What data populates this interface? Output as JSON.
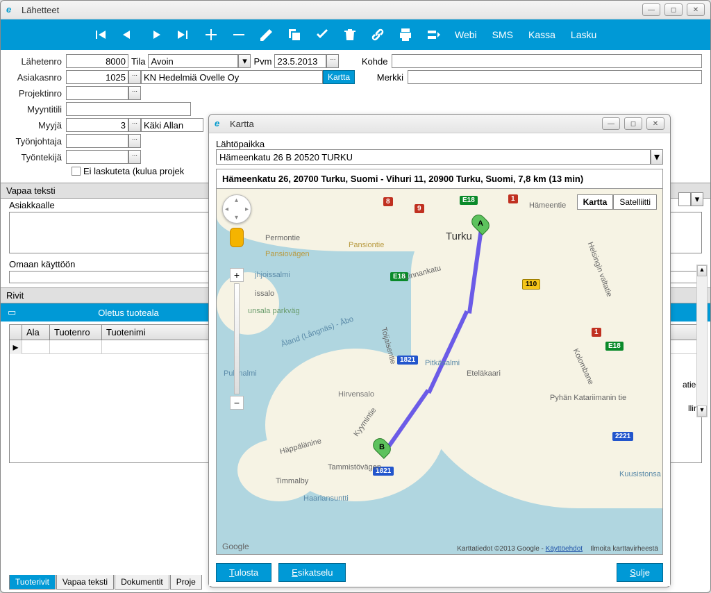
{
  "main": {
    "title": "Lähetteet",
    "toolbar_text": [
      "Webi",
      "SMS",
      "Kassa",
      "Lasku"
    ],
    "fields": {
      "lahetenro_label": "Lähetenro",
      "lahetenro": "8000",
      "tila_label": "Tila",
      "tila": "Avoin",
      "pvm_label": "Pvm",
      "pvm": "23.5.2013",
      "kohde_label": "Kohde",
      "merkki_label": "Merkki",
      "asiakasnro_label": "Asiakasnro",
      "asiakasnro": "1025",
      "asiakasnimi": "KN Hedelmiä Ovelle Oy",
      "kartta_btn": "Kartta",
      "projektinro_label": "Projektinro",
      "myyntitili_label": "Myyntitili",
      "myyja_label": "Myyjä",
      "myyja": "3",
      "myyja_nimi": "Käki Allan",
      "tyonjohtaja_label": "Työnjohtaja",
      "tyontekija_label": "Työntekijä",
      "ei_laskuteta": "Ei laskuteta (kulua projek"
    },
    "sections": {
      "vapaa_teksti": "Vapaa teksti",
      "asiakkaalle": "Asiakkaalle",
      "omaan_kayttoon": "Omaan käyttöön",
      "rivit": "Rivit",
      "oletus_tuoteala": "Oletus tuoteala",
      "atiedot": "atiedot",
      "llinen": "llinen"
    },
    "grid_headers": [
      "Ala",
      "Tuotenro",
      "Tuotenimi"
    ],
    "tabs": [
      "Tuoterivit",
      "Vapaa teksti",
      "Dokumentit",
      "Proje"
    ]
  },
  "map_dialog": {
    "title": "Kartta",
    "lahtopaikka_label": "Lähtöpaikka",
    "lahtopaikka": "Hämeenkatu 26 B 20520 TURKU",
    "route_header": "Hämeenkatu 26, 20700 Turku, Suomi - Vihuri 11, 20900 Turku, Suomi, 7,8 km (13 min)",
    "map_type_kartta": "Kartta",
    "map_type_satelliitti": "Satelliitti",
    "marker_a": "A",
    "marker_b": "B",
    "city_label": "Turku",
    "labels": {
      "permontie": "Permontie",
      "pansiovagen": "Pansiovägen",
      "pansiontie": "Pansiontie",
      "jhjoissalmi": "jhjoissalmi",
      "issalo": "issalo",
      "unsala_parkvag": "unsala parkväg",
      "aland": "Åland (Långnäs) - Åbo",
      "linnankatu": "Linnankatu",
      "pukinalmi": "Pukinalmi",
      "hirvensalo": "Hirvensalo",
      "tammistovagen": "Tammistövägen",
      "haarlansuntti": "Haarlansuntti",
      "pitkasalmi": "Pitkäsalmi",
      "etelakaari": "Eteläkaari",
      "hameentie": "Hämeentie",
      "pyhankat": "Pyhän Katariimanin tie",
      "helsingin": "Helsingin valtatie",
      "kuusistonsa": "Kuusistonsa",
      "toijaisentie": "Toijaisentie",
      "kyymintie": "Kyymintie",
      "haapalinne": "Häppälänine",
      "timmalby": "Timmalby",
      "kolombane": "Kolombane"
    },
    "shields": {
      "e18_1": "E18",
      "e18_2": "E18",
      "e18_3": "E18",
      "r1": "1",
      "r8": "8",
      "r9": "9",
      "r110": "110",
      "r1821_1": "1821",
      "r1821_2": "1821",
      "r2221": "2221"
    },
    "credits_text": "Karttatiedot ©2013 Google - ",
    "credits_link1": "Käyttöehdot",
    "credits_report": "Ilmoita karttavirheestä",
    "logo": "Google",
    "buttons": {
      "tulosta": "Tulosta",
      "tulosta_u": "T",
      "esikatselu": "Esikatselu",
      "esikatselu_u": "E",
      "sulje": "Sulje",
      "sulje_u": "S"
    }
  }
}
